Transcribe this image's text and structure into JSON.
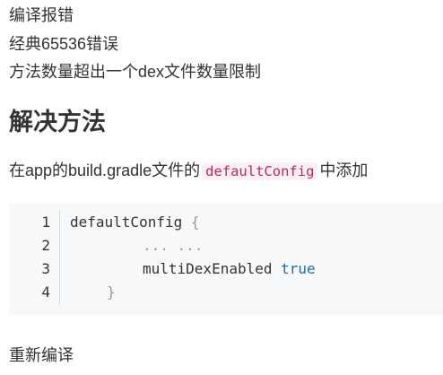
{
  "paragraphs": {
    "p1": "编译报错",
    "p2": "经典65536错误",
    "p3": "方法数量超出一个dex文件数量限制",
    "p5": "重新编译"
  },
  "heading": "解决方法",
  "instruction": {
    "prefix": "在app的build.gradle文件的",
    "code": "defaultConfig",
    "suffix": "中添加"
  },
  "code_block": {
    "line_numbers": [
      "1",
      "2",
      "3",
      "4"
    ],
    "line1": {
      "name": "defaultConfig ",
      "brace": "{"
    },
    "line2": {
      "dots": "... ..."
    },
    "line3": {
      "key": "multiDexEnabled ",
      "value": "true"
    },
    "line4": {
      "brace": "}"
    }
  },
  "colors": {
    "inline_code_text": "#c7254e",
    "inline_code_bg": "#f9f2f4",
    "code_bg": "#f6f8fa",
    "keyword": "#1a6fa8"
  }
}
